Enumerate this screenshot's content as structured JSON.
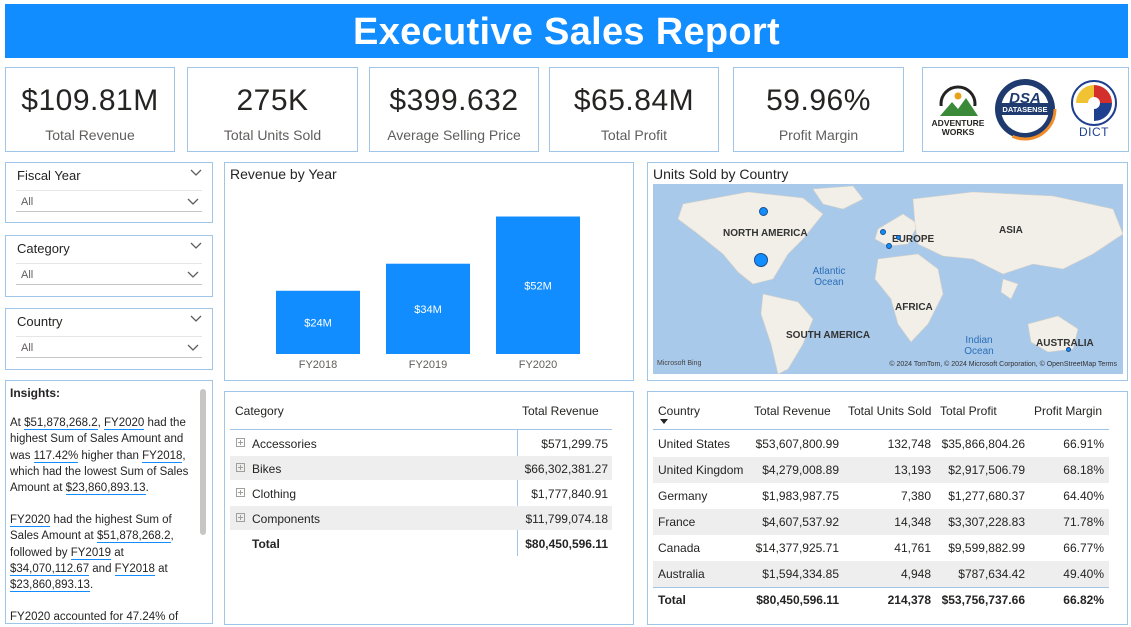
{
  "header": {
    "title": "Executive Sales Report"
  },
  "kpis": [
    {
      "value": "$109.81M",
      "label": "Total Revenue"
    },
    {
      "value": "275K",
      "label": "Total Units Sold"
    },
    {
      "value": "$399.632",
      "label": "Average Selling Price"
    },
    {
      "value": "$65.84M",
      "label": "Total Profit"
    },
    {
      "value": "59.96%",
      "label": "Profit Margin"
    }
  ],
  "logos": {
    "adventure_works": "ADVENTURE WORKS",
    "datasense": "DATASENSE",
    "dsa": "DSA",
    "dict": "DICT"
  },
  "slicers": [
    {
      "title": "Fiscal Year",
      "value": "All"
    },
    {
      "title": "Category",
      "value": "All"
    },
    {
      "title": "Country",
      "value": "All"
    }
  ],
  "insights": {
    "title": "Insights:",
    "p1": {
      "a": "At ",
      "v1": "$51,878,268.2",
      "b": ", ",
      "v2": "FY2020",
      "c": " had the highest Sum of Sales Amount and was ",
      "v3": "117.42%",
      "d": " higher than ",
      "v4": "FY2018",
      "e": ", which had the lowest Sum of Sales Amount at ",
      "v5": "$23,860,893.13",
      "f": "."
    },
    "p2": {
      "v1": "FY2020",
      "a": " had the highest Sum of Sales Amount at ",
      "v2": "$51,878,268.2",
      "b": ", followed by ",
      "v3": "FY2019",
      "c": " at ",
      "v4": "$34,070,112.67",
      "d": " and ",
      "v5": "FY2018",
      "e": " at ",
      "v6": "$23,860,893.13",
      "f": "."
    },
    "p3": "FY2020 accounted for 47.24% of"
  },
  "revenue_chart": {
    "title": "Revenue by Year",
    "bar_color": "#118dff"
  },
  "chart_data": {
    "type": "bar",
    "title": "Revenue by Year",
    "categories": [
      "FY2018",
      "FY2019",
      "FY2020"
    ],
    "values": [
      23.86,
      34.07,
      51.88
    ],
    "data_labels": [
      "$24M",
      "$34M",
      "$52M"
    ],
    "ylim": [
      0,
      60
    ],
    "grid": false
  },
  "map": {
    "title": "Units Sold by Country",
    "labels": {
      "north_america": "NORTH AMERICA",
      "europe": "EUROPE",
      "asia": "ASIA",
      "africa": "AFRICA",
      "south_america": "SOUTH AMERICA",
      "australia": "AUSTRALIA",
      "atlantic": "Atlantic Ocean",
      "indian": "Indian Ocean"
    },
    "attribution": "© 2024 TomTom, © 2024 Microsoft Corporation, © OpenStreetMap  Terms",
    "bing": "Microsoft Bing"
  },
  "category_table": {
    "headers": [
      "Category",
      "Total Revenue"
    ],
    "rows": [
      {
        "category": "Accessories",
        "revenue": "$571,299.75"
      },
      {
        "category": "Bikes",
        "revenue": "$66,302,381.27"
      },
      {
        "category": "Clothing",
        "revenue": "$1,777,840.91"
      },
      {
        "category": "Components",
        "revenue": "$11,799,074.18"
      }
    ],
    "total": {
      "label": "Total",
      "revenue": "$80,450,596.11"
    }
  },
  "country_table": {
    "headers": [
      "Country",
      "Total Revenue",
      "Total Units Sold",
      "Total Profit",
      "Profit Margin"
    ],
    "rows": [
      [
        "United States",
        "$53,607,800.99",
        "132,748",
        "$35,866,804.26",
        "66.91%"
      ],
      [
        "United Kingdom",
        "$4,279,008.89",
        "13,193",
        "$2,917,506.79",
        "68.18%"
      ],
      [
        "Germany",
        "$1,983,987.75",
        "7,380",
        "$1,277,680.37",
        "64.40%"
      ],
      [
        "France",
        "$4,607,537.92",
        "14,348",
        "$3,307,228.83",
        "71.78%"
      ],
      [
        "Canada",
        "$14,377,925.71",
        "41,761",
        "$9,599,882.99",
        "66.77%"
      ],
      [
        "Australia",
        "$1,594,334.85",
        "4,948",
        "$787,634.42",
        "49.40%"
      ]
    ],
    "total": [
      "Total",
      "$80,450,596.11",
      "214,378",
      "$53,756,737.66",
      "66.82%"
    ]
  }
}
